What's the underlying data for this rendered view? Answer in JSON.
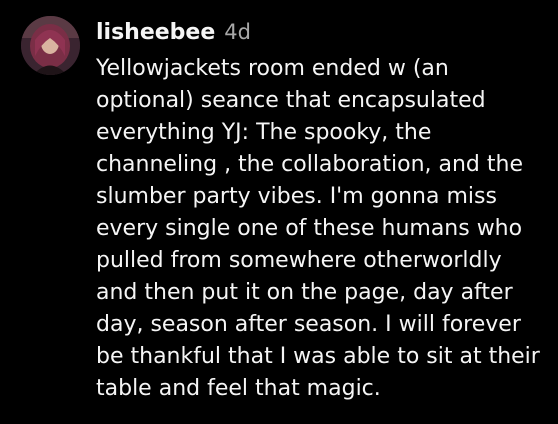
{
  "comment": {
    "username": "lisheebee",
    "timestamp": "4d",
    "text_lines": [
      "Yellowjackets room ended w (an",
      "optional) seance that encapsulated",
      "everything YJ: The spooky, the",
      "channeling , the collaboration, and the",
      "slumber party vibes. I'm gonna miss",
      "every single one of these humans who",
      "pulled from somewhere otherworldly",
      "and then put it on the page, day after",
      "day, season after season. I will forever",
      "be thankful that I was able to sit at their",
      "table and feel that magic."
    ]
  },
  "colors": {
    "background": "#000000",
    "text": "#f5f5f5",
    "muted": "#a8a8a8"
  }
}
